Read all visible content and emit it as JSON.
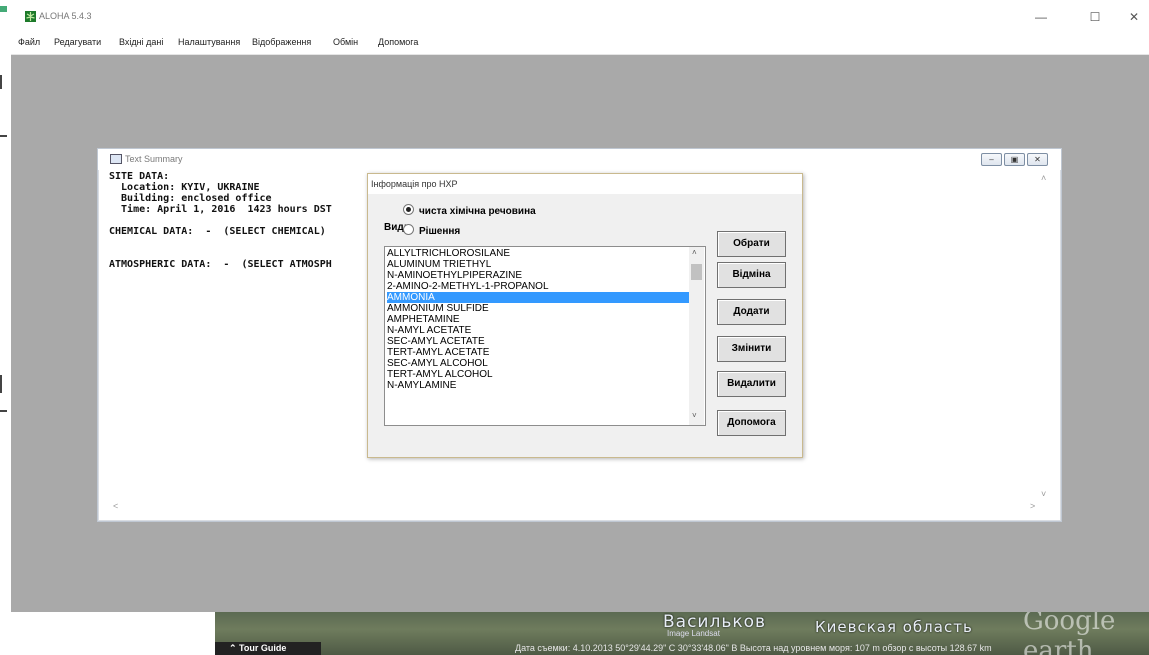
{
  "background": {
    "tour_guide": "Tour Guide",
    "city_label": "Васильков",
    "imagery_label": "Image Landsat",
    "region_label": "Киевская область",
    "logo_text": "Google earth",
    "status_line": "Дата съемки: 4.10.2013   50°29'44.29\" С   30°33'48.06\" В  Высота над уровнем моря:  107 m    обзор с высоты 128.67 km"
  },
  "window": {
    "title": "ALOHA 5.4.3",
    "controls": [
      "—",
      "☐",
      "✕"
    ]
  },
  "menu": [
    "Файл",
    "Редагувати",
    "Вхідні дані",
    "Налаштування",
    "Відображення",
    "Обмін",
    "Допомога"
  ],
  "summary": {
    "title": "Text Summary",
    "lines": [
      "SITE DATA:",
      "  Location: KYIV, UKRAINE",
      "  Building: enclosed office",
      "  Time: April 1, 2016  1423 hours DST",
      "",
      "CHEMICAL DATA:  -  (SELECT CHEMICAL)",
      "",
      "ATMOSPHERIC DATA:  -  (SELECT ATMOSPH"
    ]
  },
  "dialog": {
    "title": "Інформація про НХР",
    "vid_label": "Вид:",
    "radios": [
      {
        "label": "чиста хімічна речовина",
        "checked": true
      },
      {
        "label": "Рішення",
        "checked": false
      }
    ],
    "chemicals": [
      "ALLYLTRICHLOROSILANE",
      "ALUMINUM TRIETHYL",
      "N-AMINOETHYLPIPERAZINE",
      "2-AMINO-2-METHYL-1-PROPANOL",
      "AMMONIA",
      "AMMONIUM SULFIDE",
      "AMPHETAMINE",
      "N-AMYL ACETATE",
      "SEC-AMYL ACETATE",
      "TERT-AMYL ACETATE",
      "SEC-AMYL ALCOHOL",
      "TERT-AMYL ALCOHOL",
      "N-AMYLAMINE"
    ],
    "selected_index": 4,
    "buttons": [
      "Обрати",
      "Відміна",
      "Додати",
      "Змінити",
      "Видалити",
      "Допомога"
    ]
  }
}
